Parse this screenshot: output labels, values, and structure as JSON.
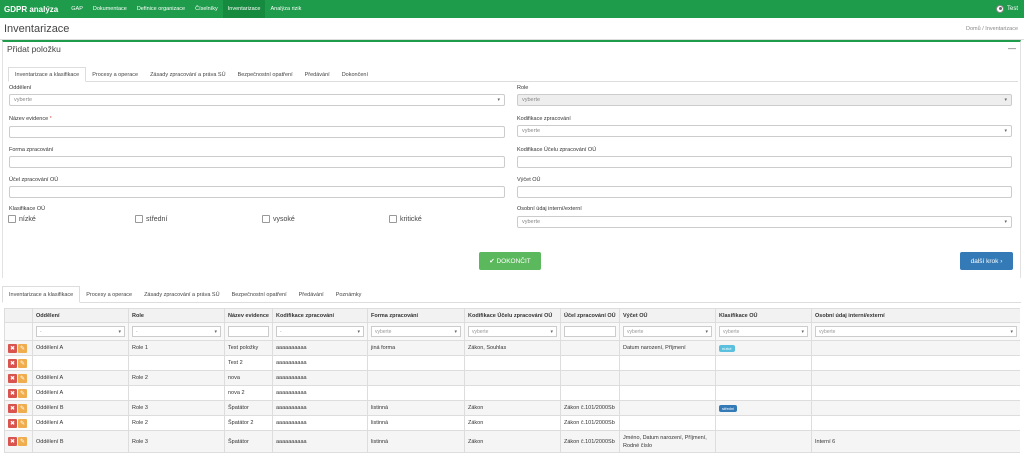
{
  "app": {
    "brand": "GDPR analýza",
    "nav": [
      "GAP",
      "Dokumentace",
      "Definice organizace",
      "Číselníky",
      "Inventarizace",
      "Analýza rizik"
    ],
    "active_nav": 4,
    "user": "Test"
  },
  "page": {
    "title": "Inventarizace",
    "breadcrumb": "Domů / Inventarizace"
  },
  "panel": {
    "title": "Přidat položku",
    "collapse": "—"
  },
  "tabs": [
    "Inventarizace a klasifikace",
    "Procesy a operace",
    "Zásady zpracování a práva SÚ",
    "Bezpečnostní opatření",
    "Předávání",
    "Dokončení"
  ],
  "form": {
    "oddeleni": {
      "label": "Oddělení",
      "placeholder": "vyberte"
    },
    "role": {
      "label": "Role",
      "placeholder": "vyberte"
    },
    "nazev": {
      "label": "Název evidence",
      "required": "*"
    },
    "kod_zpracovani": {
      "label": "Kodifikace zpracování",
      "placeholder": "vyberte"
    },
    "forma": {
      "label": "Forma zpracování"
    },
    "kod_ucelu": {
      "label": "Kodifikace Účelu zpracování OÚ"
    },
    "ucel": {
      "label": "Účel zpracování OÚ"
    },
    "vycet": {
      "label": "Výčet OÚ"
    },
    "klasifikace": {
      "label": "Klasifikace OÚ",
      "options": [
        "nízké",
        "střední",
        "vysoké",
        "kritické"
      ]
    },
    "osobni": {
      "label": "Osobní údaj interní/externí",
      "placeholder": "vyberte"
    }
  },
  "buttons": {
    "finish": "✔ DOKONČIT",
    "next": "další krok ›"
  },
  "tabs2": [
    "Inventarizace a klasifikace",
    "Procesy a operace",
    "Zásady zpracování a práva SÚ",
    "Bezpečnostní opatření",
    "Předávání",
    "Poznámky"
  ],
  "table": {
    "columns": [
      "",
      "Oddělení",
      "Role",
      "Název evidence",
      "Kodifikace zpracování",
      "Forma zpracování",
      "Kodifikace Účelu zpracování OÚ",
      "Účel zpracování OÚ",
      "Výčet OÚ",
      "Klasifikace OÚ",
      "Osobní údaj interní/externí"
    ],
    "filters": [
      "",
      "-",
      "-",
      "",
      "-",
      "vyberte",
      "vyberte",
      "",
      "vyberte",
      "vyberte",
      "vyberte"
    ],
    "rows": [
      [
        "",
        "Oddělení A",
        "Role 1",
        "Test položky",
        "aaaaaaaaaa",
        "jiná forma",
        "Zákon, Souhlas",
        "",
        "Datum narození, Příjmení",
        "nízké",
        ""
      ],
      [
        "",
        "",
        "",
        "Test 2",
        "aaaaaaaaaa",
        "",
        "",
        "",
        "",
        "",
        ""
      ],
      [
        "",
        "Oddělení A",
        "Role 2",
        "nova",
        "aaaaaaaaaa",
        "",
        "",
        "",
        "",
        "",
        ""
      ],
      [
        "",
        "Oddělení A",
        "",
        "nova 2",
        "aaaaaaaaaa",
        "",
        "",
        "",
        "",
        "",
        ""
      ],
      [
        "",
        "Oddělení B",
        "Role 3",
        "Špatátor",
        "aaaaaaaaaa",
        "listinná",
        "Zákon",
        "Zákon č.101/2000Sb",
        "",
        "střední",
        ""
      ],
      [
        "",
        "Oddělení A",
        "Role 2",
        "Špatátor 2",
        "aaaaaaaaaa",
        "listinná",
        "Zákon",
        "Zákon č.101/2000Sb",
        "",
        "",
        ""
      ],
      [
        "",
        "Oddělení B",
        "Role 3",
        "Špatátor",
        "aaaaaaaaaa",
        "listinná",
        "Zákon",
        "Zákon č.101/2000Sb",
        "Jméno, Datum narození, Příjmení, Rodné číslo",
        "",
        "Interní 6"
      ]
    ],
    "badge_colors": {
      "nízké": "#5bc0de",
      "střední": "#337ab7"
    }
  }
}
